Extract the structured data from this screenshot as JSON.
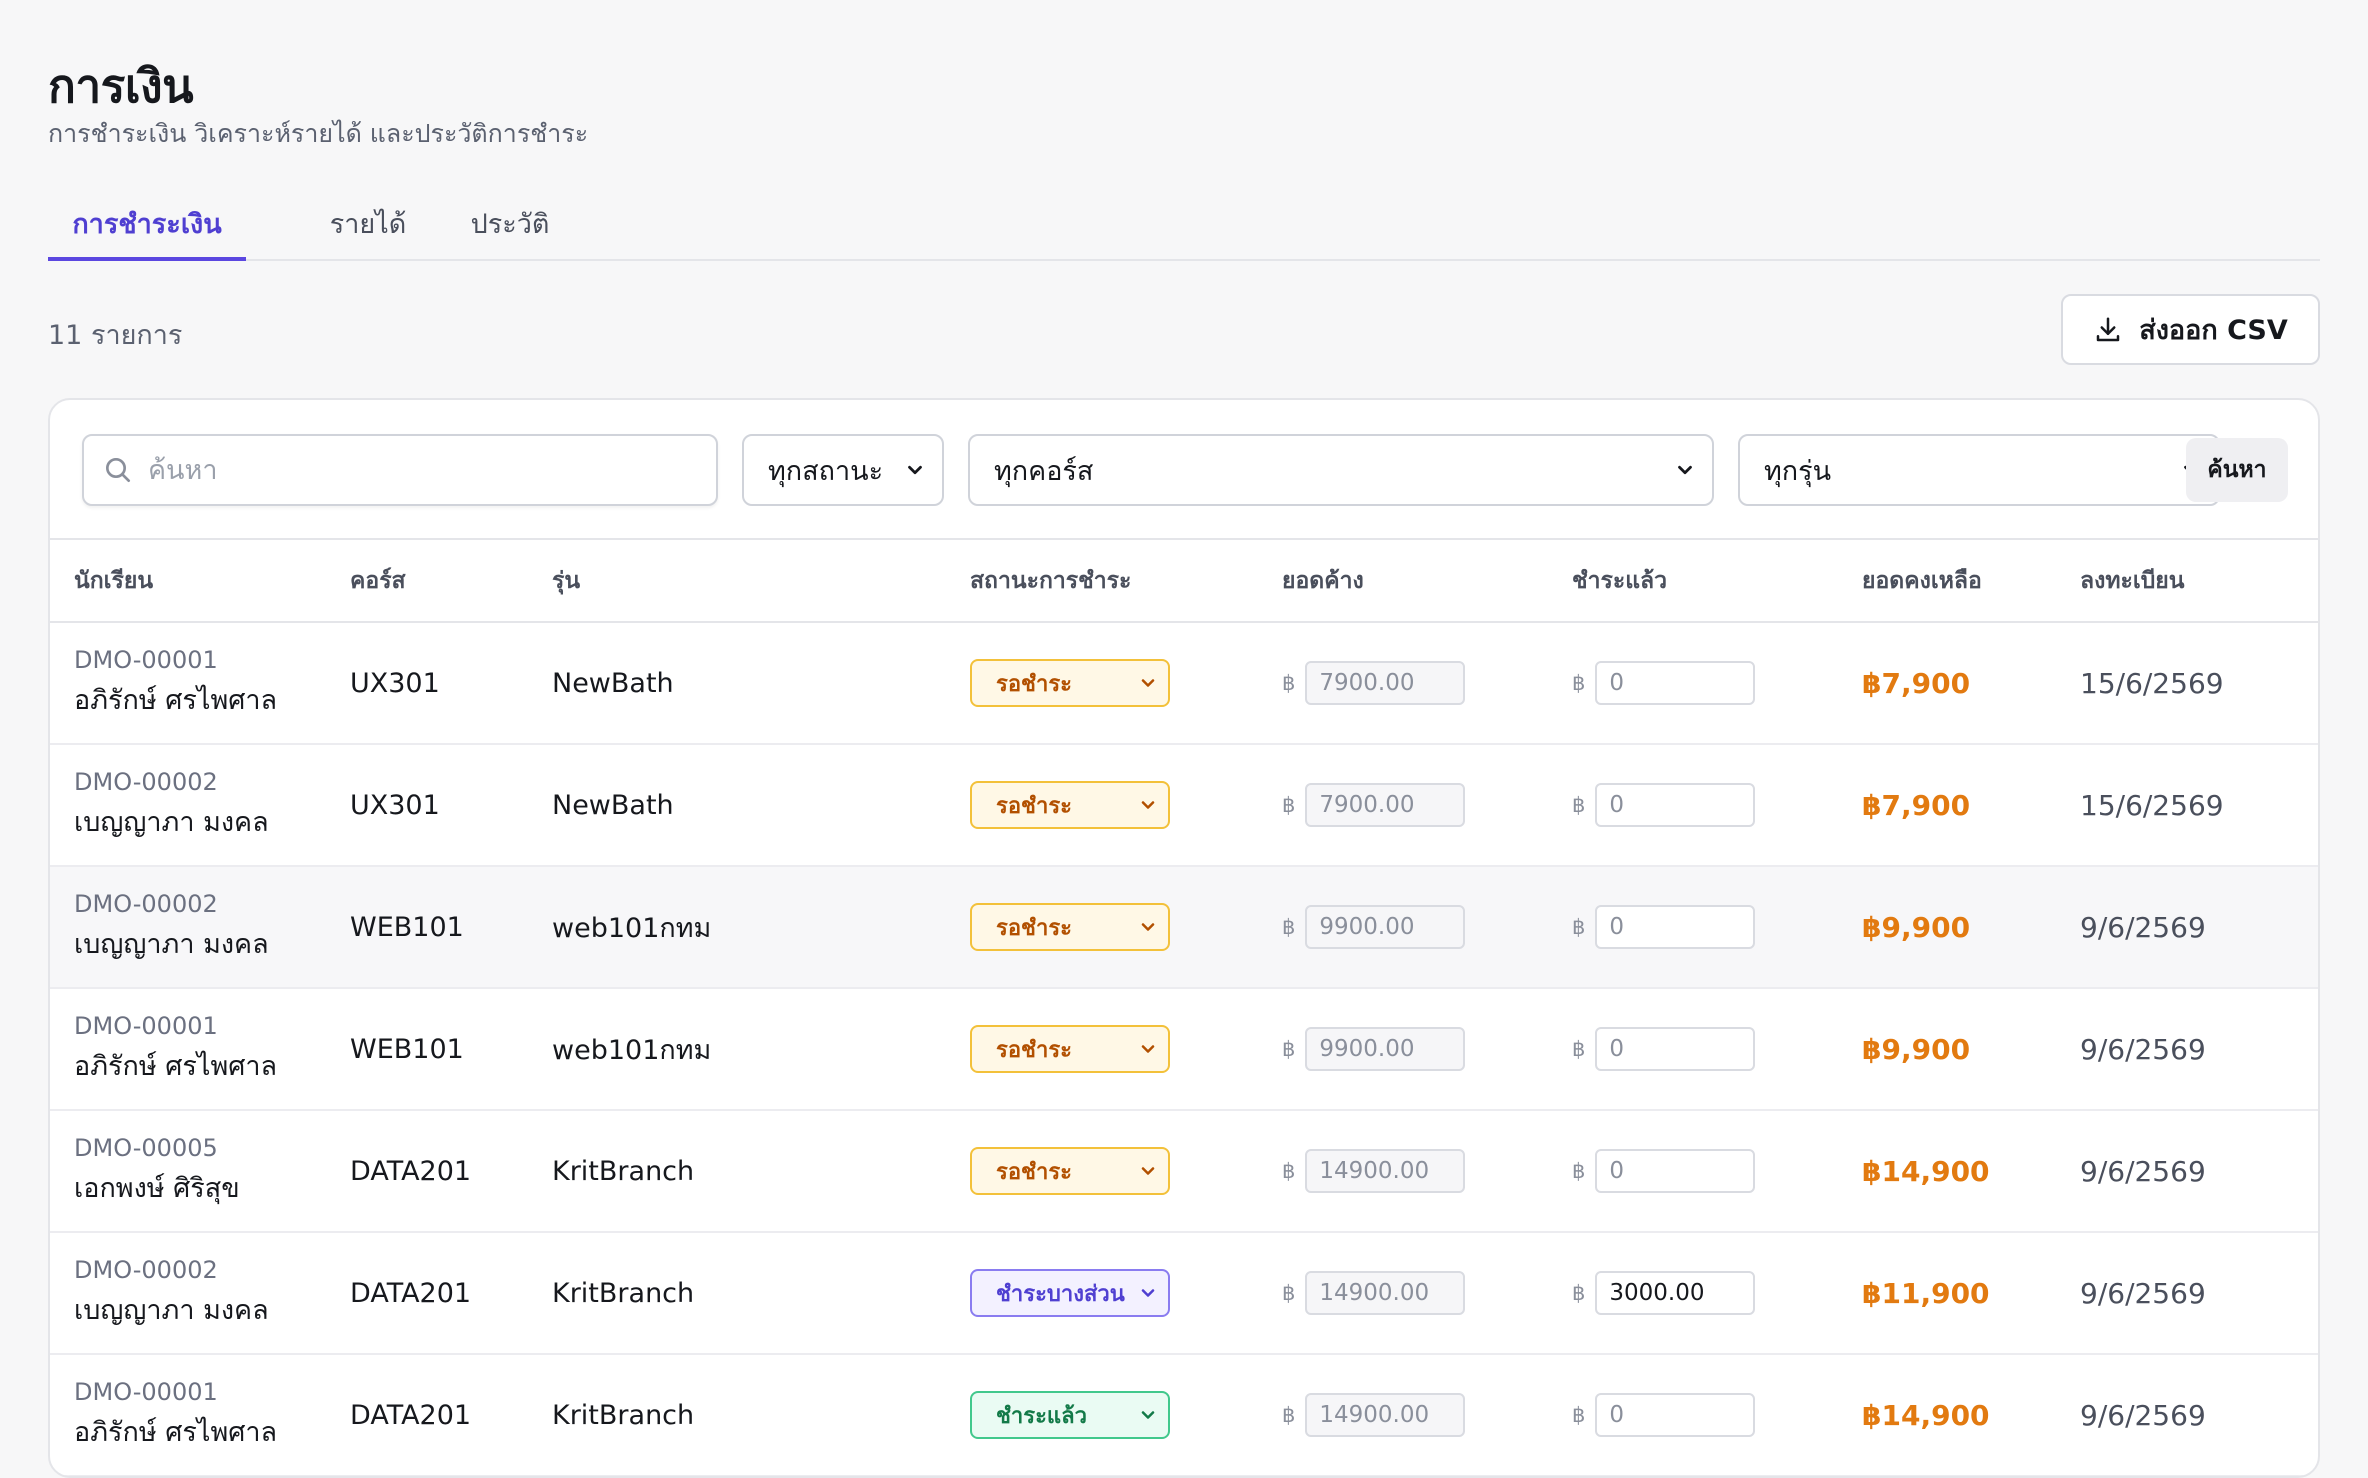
{
  "header": {
    "title": "การเงิน",
    "subtitle": "การชำระเงิน วิเคราะห์รายได้ และประวัติการชำระ"
  },
  "tabs": [
    {
      "label": "การชำระเงิน",
      "active": true
    },
    {
      "label": "รายได้",
      "active": false
    },
    {
      "label": "ประวัติ",
      "active": false
    }
  ],
  "toolbar": {
    "count_text": "11 รายการ",
    "export_label": "ส่งออก CSV",
    "export_icon": "download-icon"
  },
  "filters": {
    "search_placeholder": "ค้นหา",
    "status_value": "ทุกสถานะ",
    "course_value": "ทุกคอร์ส",
    "batch_value": "ทุกรุ่น",
    "search_button": "ค้นหา"
  },
  "table": {
    "columns": [
      "นักเรียน",
      "คอร์ส",
      "รุ่น",
      "สถานะการชำระ",
      "ยอดค้าง",
      "ชำระแล้ว",
      "ยอดคงเหลือ",
      "ลงทะเบียน"
    ],
    "currency_symbol": "฿",
    "rows": [
      {
        "id": "DMO-00001",
        "name": "อภิรักษ์ ศรไพศาล",
        "course": "UX301",
        "batch": "NewBath",
        "status": "รอชำระ",
        "status_kind": "pending",
        "due": "7900.00",
        "paid": "0",
        "remain": "฿7,900",
        "date": "15/6/2569"
      },
      {
        "id": "DMO-00002",
        "name": "เบญญาภา มงคล",
        "course": "UX301",
        "batch": "NewBath",
        "status": "รอชำระ",
        "status_kind": "pending",
        "due": "7900.00",
        "paid": "0",
        "remain": "฿7,900",
        "date": "15/6/2569"
      },
      {
        "id": "DMO-00002",
        "name": "เบญญาภา มงคล",
        "course": "WEB101",
        "batch": "web101กทม",
        "status": "รอชำระ",
        "status_kind": "pending",
        "due": "9900.00",
        "paid": "0",
        "remain": "฿9,900",
        "date": "9/6/2569"
      },
      {
        "id": "DMO-00001",
        "name": "อภิรักษ์ ศรไพศาล",
        "course": "WEB101",
        "batch": "web101กทม",
        "status": "รอชำระ",
        "status_kind": "pending",
        "due": "9900.00",
        "paid": "0",
        "remain": "฿9,900",
        "date": "9/6/2569"
      },
      {
        "id": "DMO-00005",
        "name": "เอกพงษ์ ศิริสุข",
        "course": "DATA201",
        "batch": "KritBranch",
        "status": "รอชำระ",
        "status_kind": "pending",
        "due": "14900.00",
        "paid": "0",
        "remain": "฿14,900",
        "date": "9/6/2569"
      },
      {
        "id": "DMO-00002",
        "name": "เบญญาภา มงคล",
        "course": "DATA201",
        "batch": "KritBranch",
        "status": "ชำระบางส่วน",
        "status_kind": "partial",
        "due": "14900.00",
        "paid": "3000.00",
        "remain": "฿11,900",
        "date": "9/6/2569"
      },
      {
        "id": "DMO-00001",
        "name": "อภิรักษ์ ศรไพศาล",
        "course": "DATA201",
        "batch": "KritBranch",
        "status": "ชำระแล้ว",
        "status_kind": "paid",
        "due": "14900.00",
        "paid": "0",
        "remain": "฿14,900",
        "date": "9/6/2569"
      }
    ]
  },
  "colors": {
    "accent": "#5b47e0",
    "remain_orange": "#e27a10",
    "pending_border": "#f3c13a",
    "partial_border": "#8a7cf0",
    "paid_border": "#42c88c"
  }
}
